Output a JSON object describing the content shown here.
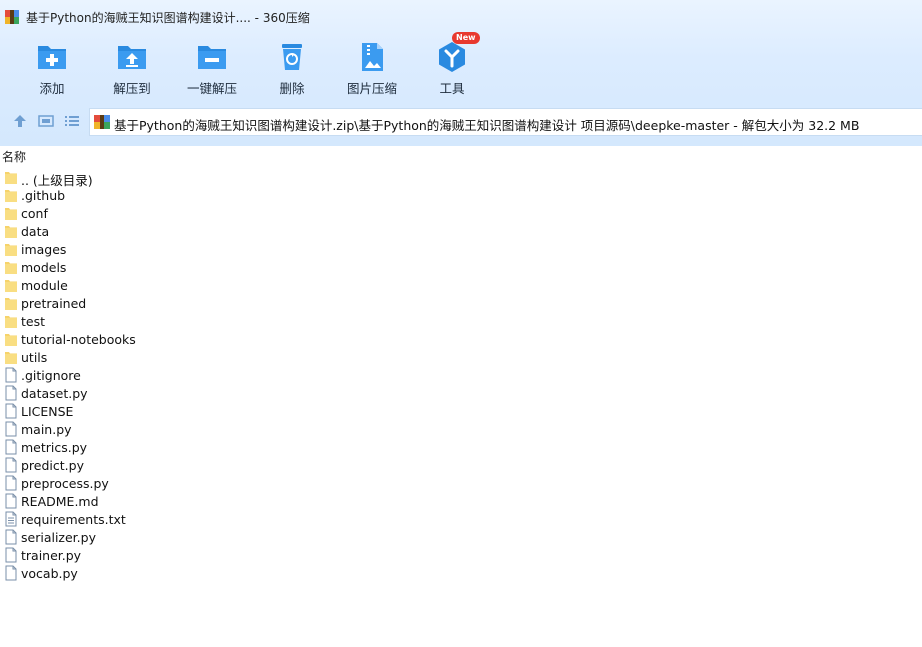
{
  "window": {
    "title": "基于Python的海贼王知识图谱构建设计.... - 360压缩"
  },
  "toolbar": {
    "items": [
      {
        "label": "添加",
        "icon": "add-icon"
      },
      {
        "label": "解压到",
        "icon": "extract-to-icon"
      },
      {
        "label": "一键解压",
        "icon": "one-click-extract-icon"
      },
      {
        "label": "删除",
        "icon": "delete-icon"
      },
      {
        "label": "图片压缩",
        "icon": "image-compress-icon"
      },
      {
        "label": "工具",
        "icon": "tools-icon",
        "badge": "New"
      }
    ]
  },
  "address": {
    "path": "基于Python的海贼王知识图谱构建设计.zip\\基于Python的海贼王知识图谱构建设计 项目源码\\deepke-master - 解包大小为 32.2 MB"
  },
  "list_header": {
    "name_column": "名称"
  },
  "files": [
    {
      "name": ".. (上级目录)",
      "type": "folder"
    },
    {
      "name": ".github",
      "type": "folder"
    },
    {
      "name": "conf",
      "type": "folder"
    },
    {
      "name": "data",
      "type": "folder"
    },
    {
      "name": "images",
      "type": "folder"
    },
    {
      "name": "models",
      "type": "folder"
    },
    {
      "name": "module",
      "type": "folder"
    },
    {
      "name": "pretrained",
      "type": "folder"
    },
    {
      "name": "test",
      "type": "folder"
    },
    {
      "name": "tutorial-notebooks",
      "type": "folder"
    },
    {
      "name": "utils",
      "type": "folder"
    },
    {
      "name": ".gitignore",
      "type": "file"
    },
    {
      "name": "dataset.py",
      "type": "file"
    },
    {
      "name": "LICENSE",
      "type": "file"
    },
    {
      "name": "main.py",
      "type": "file"
    },
    {
      "name": "metrics.py",
      "type": "file"
    },
    {
      "name": "predict.py",
      "type": "file"
    },
    {
      "name": "preprocess.py",
      "type": "file"
    },
    {
      "name": "README.md",
      "type": "file"
    },
    {
      "name": "requirements.txt",
      "type": "text"
    },
    {
      "name": "serializer.py",
      "type": "file"
    },
    {
      "name": "trainer.py",
      "type": "file"
    },
    {
      "name": "vocab.py",
      "type": "file"
    }
  ],
  "colors": {
    "toolbar_icon": "#2a8ae0",
    "folder": "#f6d36b",
    "badge": "#e8392f"
  }
}
